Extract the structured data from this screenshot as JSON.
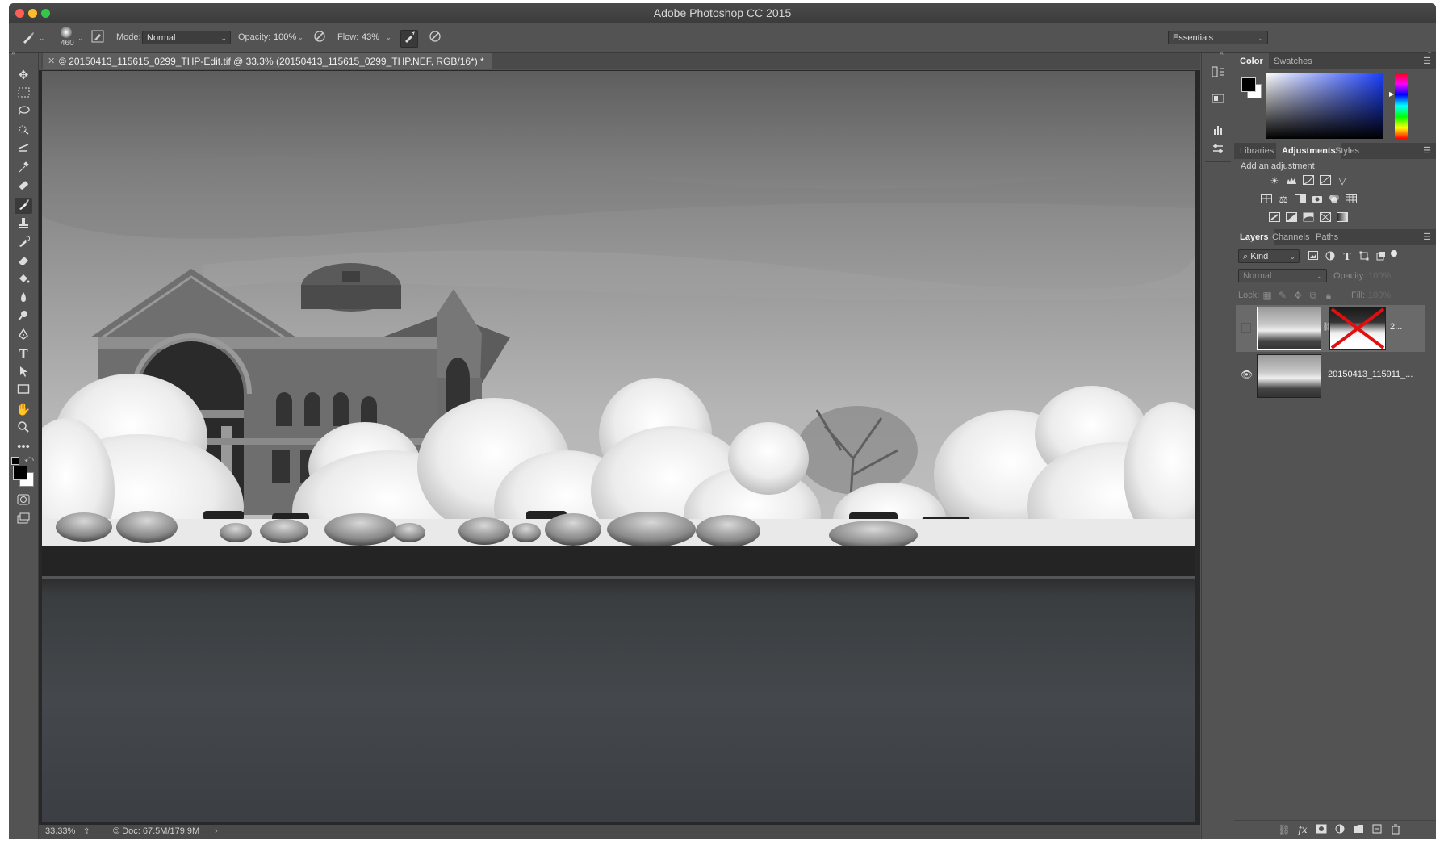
{
  "window": {
    "title": "Adobe Photoshop CC 2015"
  },
  "options_bar": {
    "brush_size": "460",
    "mode_label": "Mode:",
    "mode_value": "Normal",
    "opacity_label": "Opacity:",
    "opacity_value": "100%",
    "flow_label": "Flow:",
    "flow_value": "43%",
    "workspace": "Essentials"
  },
  "document": {
    "tab_title": "© 20150413_115615_0299_THP-Edit.tif @ 33.3% (20150413_115615_0299_THP.NEF, RGB/16*) *",
    "zoom": "33.33%",
    "doc_size": "© Doc: 67.5M/179.9M"
  },
  "color_panel": {
    "tabs": [
      "Color",
      "Swatches"
    ],
    "foreground": "#000000",
    "background": "#ffffff"
  },
  "adjustments_panel": {
    "tabs": [
      "Libraries",
      "Adjustments",
      "Styles"
    ],
    "heading": "Add an adjustment"
  },
  "layers_panel": {
    "tabs": [
      "Layers",
      "Channels",
      "Paths"
    ],
    "filter_kind": "Kind",
    "blend_mode": "Normal",
    "opacity_label": "Opacity:",
    "opacity_value": "100%",
    "lock_label": "Lock:",
    "fill_label": "Fill:",
    "fill_value": "100%",
    "layers": [
      {
        "name": "2...",
        "visible": false
      },
      {
        "name": "20150413_115911_...",
        "visible": true
      }
    ]
  }
}
